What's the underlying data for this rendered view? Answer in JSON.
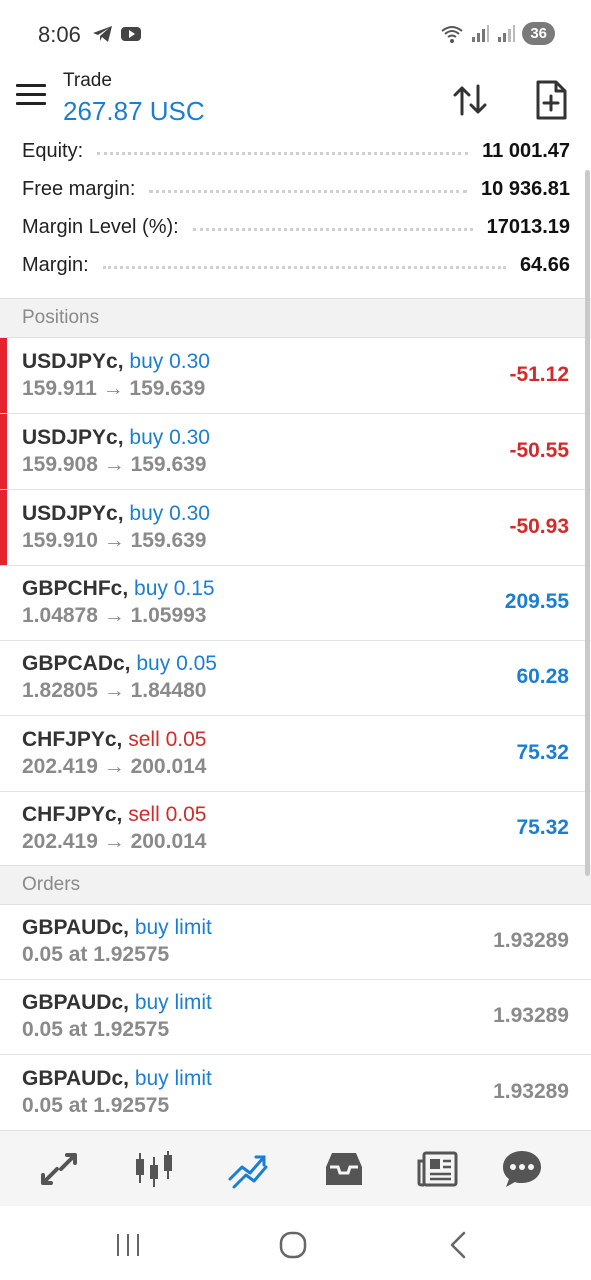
{
  "status_bar": {
    "time": "8:06",
    "battery": "36"
  },
  "header": {
    "title": "Trade",
    "balance": "267.87 USC"
  },
  "summary": [
    {
      "label": "Equity:",
      "value": "11 001.47"
    },
    {
      "label": "Free margin:",
      "value": "10 936.81"
    },
    {
      "label": "Margin Level (%):",
      "value": "17013.19"
    },
    {
      "label": "Margin:",
      "value": "64.66"
    }
  ],
  "sections": {
    "positions": "Positions",
    "orders": "Orders"
  },
  "positions": [
    {
      "symbol": "USDJPYc,",
      "trade": "buy 0.30",
      "side": "buy",
      "prices": "159.911 → 159.639",
      "profit": "-51.12"
    },
    {
      "symbol": "USDJPYc,",
      "trade": "buy 0.30",
      "side": "buy",
      "prices": "159.908 → 159.639",
      "profit": "-50.55"
    },
    {
      "symbol": "USDJPYc,",
      "trade": "buy 0.30",
      "side": "buy",
      "prices": "159.910 → 159.639",
      "profit": "-50.93"
    },
    {
      "symbol": "GBPCHFc,",
      "trade": "buy 0.15",
      "side": "buy",
      "prices": "1.04878 → 1.05993",
      "profit": "209.55"
    },
    {
      "symbol": "GBPCADc,",
      "trade": "buy 0.05",
      "side": "buy",
      "prices": "1.82805 → 1.84480",
      "profit": "60.28"
    },
    {
      "symbol": "CHFJPYc,",
      "trade": "sell 0.05",
      "side": "sell",
      "prices": "202.419 → 200.014",
      "profit": "75.32"
    },
    {
      "symbol": "CHFJPYc,",
      "trade": "sell 0.05",
      "side": "sell",
      "prices": "202.419 → 200.014",
      "profit": "75.32"
    }
  ],
  "orders": [
    {
      "symbol": "GBPAUDc,",
      "trade": "buy limit",
      "detail": "0.05 at 1.92575",
      "price": "1.93289"
    },
    {
      "symbol": "GBPAUDc,",
      "trade": "buy limit",
      "detail": "0.05 at 1.92575",
      "price": "1.93289"
    },
    {
      "symbol": "GBPAUDc,",
      "trade": "buy limit",
      "detail": "0.05 at 1.92575",
      "price": "1.93289"
    }
  ],
  "bottom_nav": [
    {
      "icon": "quotes-arrows-icon"
    },
    {
      "icon": "chart-candles-icon"
    },
    {
      "icon": "trade-trend-icon",
      "active": true
    },
    {
      "icon": "history-inbox-icon"
    },
    {
      "icon": "news-icon"
    },
    {
      "icon": "messages-icon"
    }
  ],
  "colors": {
    "accent": "#1a7fd4",
    "loss": "#d42a2a",
    "loss_marker": "#e5232e",
    "muted": "#8a8a8a"
  }
}
